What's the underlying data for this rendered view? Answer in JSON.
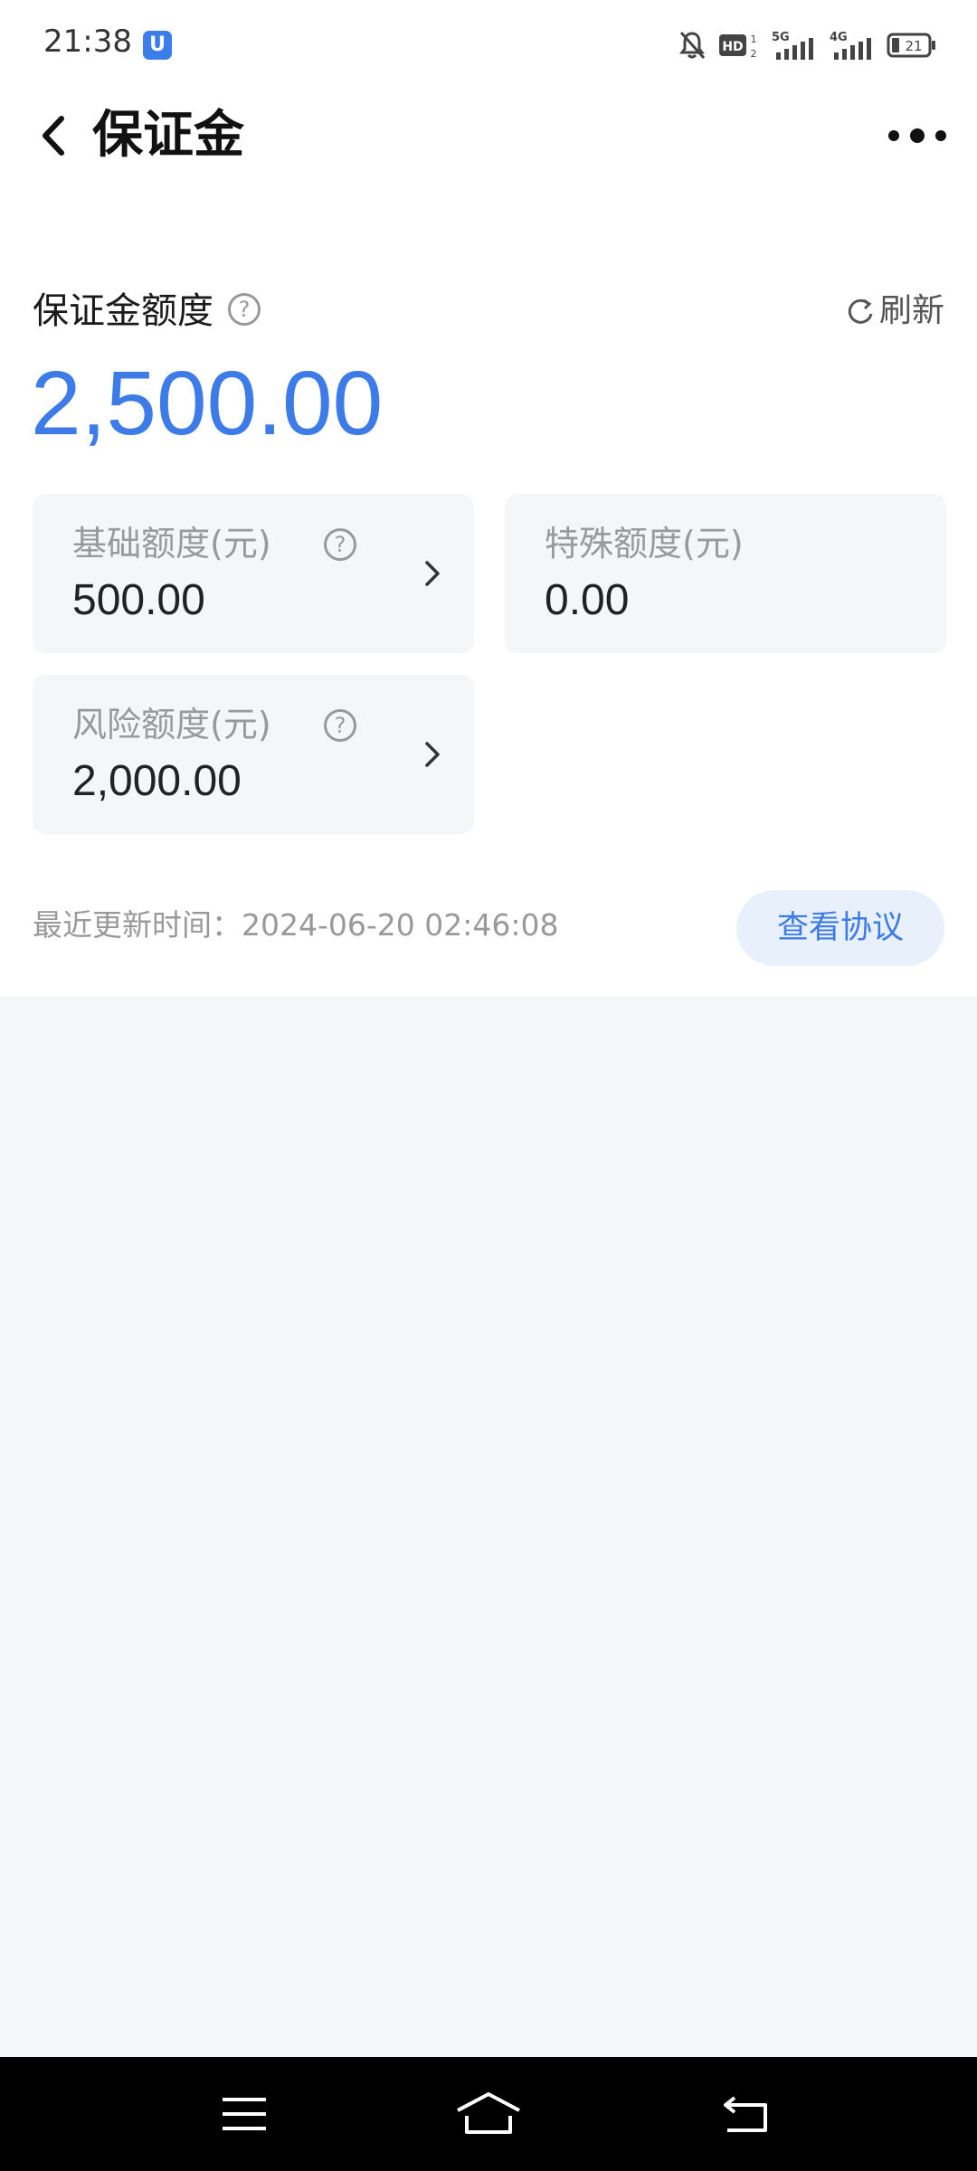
{
  "status_bar": {
    "time": "21:38",
    "app_badge": "U",
    "battery": "21",
    "icons": [
      "bell-off-icon",
      "hd-icon",
      "5g-signal-icon",
      "4g-signal-icon",
      "battery-icon"
    ]
  },
  "nav": {
    "title": "保证金"
  },
  "deposit": {
    "label": "保证金额度",
    "amount": "2,500.00",
    "refresh_label": "刷新",
    "accent_color": "#3c7be8"
  },
  "cards": [
    {
      "label": "基础额度(元)",
      "value": "500.00"
    },
    {
      "label": "特殊额度(元)",
      "value": "0.00"
    },
    {
      "label": "风险额度(元)",
      "value": "2,000.00"
    }
  ],
  "update": {
    "text": "最近更新时间：2024-06-20 02:46:08",
    "agreement_button": "查看协议"
  },
  "system_nav": {
    "icons": [
      "menu-icon",
      "home-icon",
      "back-icon"
    ]
  }
}
